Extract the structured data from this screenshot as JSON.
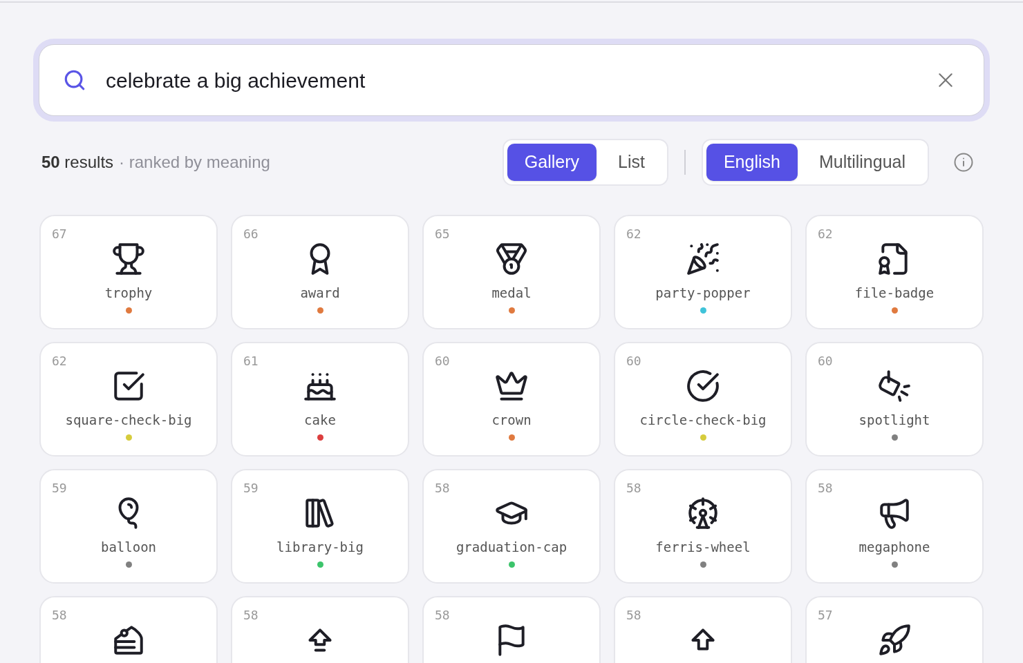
{
  "search": {
    "value": "celebrate a big achievement"
  },
  "summary": {
    "count": "**50** results",
    "note": "· ranked by meaning"
  },
  "view_toggle": [
    {
      "label": "Gallery",
      "selected": true
    },
    {
      "label": "List",
      "selected": false
    }
  ],
  "language_toggle": [
    {
      "label": "English",
      "selected": true
    },
    {
      "label": "Multilingual",
      "selected": false
    }
  ],
  "results": [
    {
      "score": "67",
      "name": "trophy",
      "color": "#e07a3f"
    },
    {
      "score": "66",
      "name": "award",
      "color": "#e07a3f"
    },
    {
      "score": "65",
      "name": "medal",
      "color": "#e07a3f"
    },
    {
      "score": "62",
      "name": "party-popper",
      "color": "#3fc3d9"
    },
    {
      "score": "62",
      "name": "file-badge",
      "color": "#e07a3f"
    },
    {
      "score": "62",
      "name": "square-check-big",
      "color": "#d6cc3c"
    },
    {
      "score": "61",
      "name": "cake",
      "color": "#dc3e3e"
    },
    {
      "score": "60",
      "name": "crown",
      "color": "#e07a3f"
    },
    {
      "score": "60",
      "name": "circle-check-big",
      "color": "#d6cc3c"
    },
    {
      "score": "60",
      "name": "spotlight",
      "color": "#808080"
    },
    {
      "score": "59",
      "name": "balloon",
      "color": "#808080"
    },
    {
      "score": "59",
      "name": "library-big",
      "color": "#3cc46b"
    },
    {
      "score": "58",
      "name": "graduation-cap",
      "color": "#3cc46b"
    },
    {
      "score": "58",
      "name": "ferris-wheel",
      "color": "#808080"
    },
    {
      "score": "58",
      "name": "megaphone",
      "color": "#808080"
    },
    {
      "score": "58"
    },
    {
      "score": "58"
    },
    {
      "score": "58"
    },
    {
      "score": "58"
    },
    {
      "score": "57"
    }
  ]
}
